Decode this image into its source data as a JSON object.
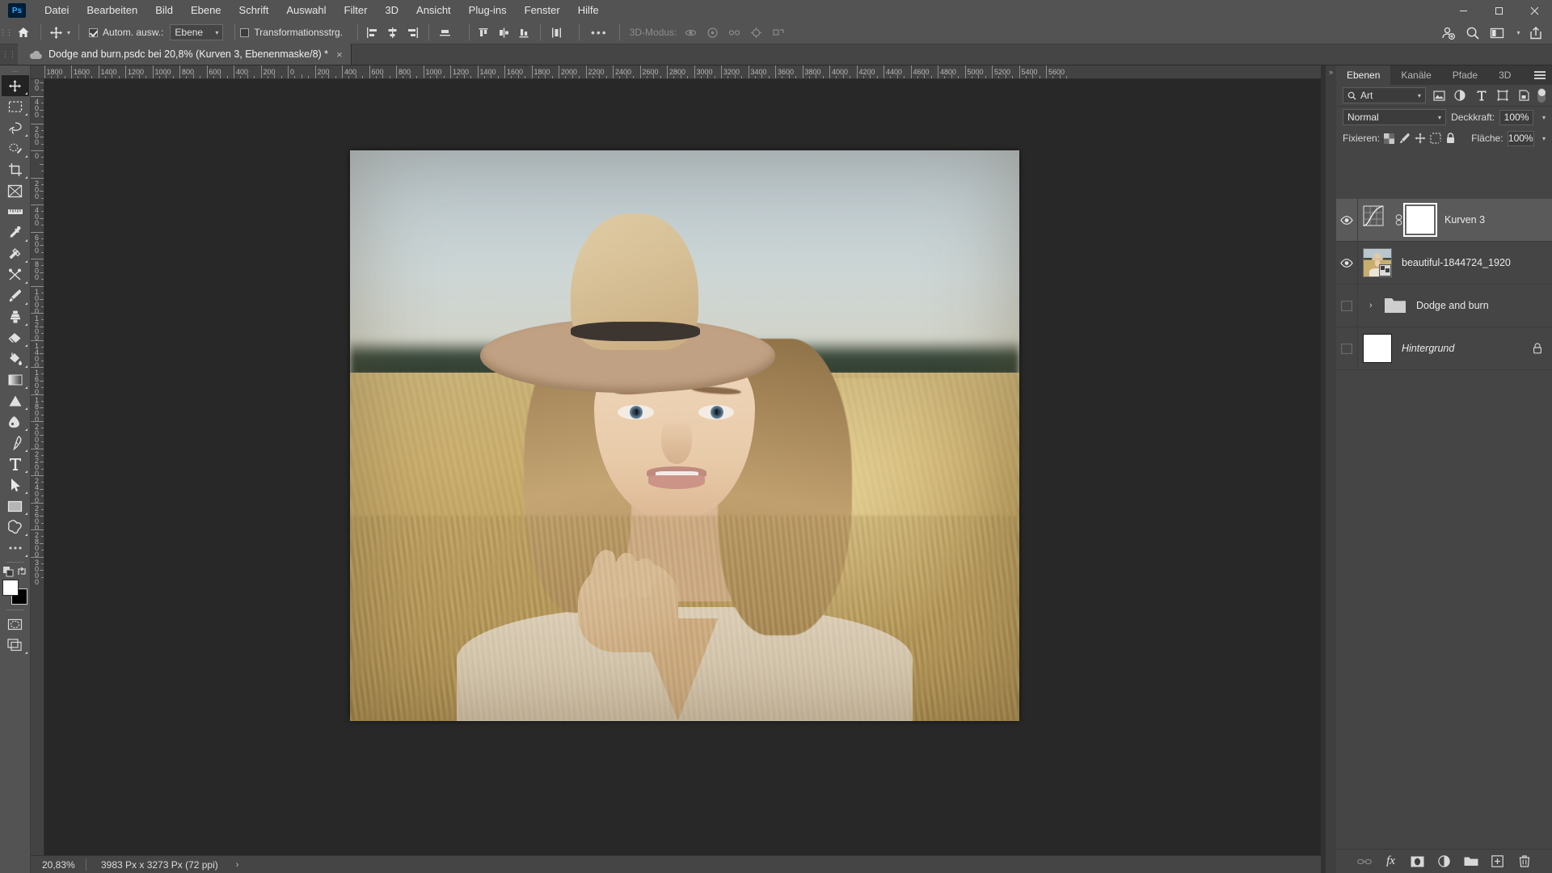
{
  "app": {
    "name": "Ps",
    "accent": "#31a8ff",
    "bg": "#535353",
    "canvas_bg": "#282828"
  },
  "menubar": {
    "items": [
      "Datei",
      "Bearbeiten",
      "Bild",
      "Ebene",
      "Schrift",
      "Auswahl",
      "Filter",
      "3D",
      "Ansicht",
      "Plug-ins",
      "Fenster",
      "Hilfe"
    ],
    "window_controls": [
      "minimize",
      "maximize",
      "close"
    ]
  },
  "optionsbar": {
    "home_icon": "home-icon",
    "tool_icon": "move-tool-icon",
    "auto_select_label": "Autom. ausw.:",
    "auto_select_checked": true,
    "auto_select_scope": "Ebene",
    "transform_controls_label": "Transformationsstrg.",
    "transform_controls_checked": false,
    "align_icons": [
      "align-left-edges-icon",
      "align-horizontal-centers-icon",
      "align-right-edges-icon",
      "align-top-edges-icon"
    ],
    "distribute_icons": [
      "distribute-top-icon",
      "distribute-vertical-centers-icon",
      "distribute-bottom-icon",
      "distribute-spacing-icon"
    ],
    "more_label": "•••",
    "mode3d_label": "3D-Modus:",
    "mode3d_icons": [
      "orbit-3d-icon",
      "roll-3d-icon",
      "pan-3d-icon",
      "slide-3d-icon",
      "scale-3d-icon"
    ],
    "right_icons": [
      "add-collaborator-icon",
      "search-icon",
      "workspace-switcher-icon",
      "share-icon"
    ]
  },
  "document_tab": {
    "title": "Dodge and burn.psdc bei 20,8% (Kurven 3, Ebenenmaske/8) *",
    "cloud_icon": "cloud-document-icon",
    "close_label": "×"
  },
  "toolbar": {
    "tools": [
      {
        "name": "move-tool",
        "selected": true,
        "has_flyout": true
      },
      {
        "name": "rectangular-marquee-tool",
        "selected": false,
        "has_flyout": true
      },
      {
        "name": "lasso-tool",
        "selected": false,
        "has_flyout": true
      },
      {
        "name": "object-selection-tool",
        "selected": false,
        "has_flyout": true
      },
      {
        "name": "crop-tool",
        "selected": false,
        "has_flyout": true
      },
      {
        "name": "frame-tool",
        "selected": false,
        "has_flyout": false
      },
      {
        "name": "measure-tool",
        "selected": false,
        "has_flyout": false
      },
      {
        "name": "eyedropper-tool",
        "selected": false,
        "has_flyout": true
      },
      {
        "name": "healing-brush-tool",
        "selected": false,
        "has_flyout": true
      },
      {
        "name": "patch-tool",
        "selected": false,
        "has_flyout": true
      },
      {
        "name": "brush-tool",
        "selected": false,
        "has_flyout": true
      },
      {
        "name": "clone-stamp-tool",
        "selected": false,
        "has_flyout": true
      },
      {
        "name": "eraser-tool",
        "selected": false,
        "has_flyout": true
      },
      {
        "name": "paint-bucket-tool",
        "selected": false,
        "has_flyout": true
      },
      {
        "name": "gradient-tool",
        "selected": false,
        "has_flyout": true
      },
      {
        "name": "dodge-tool",
        "selected": false,
        "has_flyout": true
      },
      {
        "name": "blur-tool",
        "selected": false,
        "has_flyout": true
      },
      {
        "name": "pen-tool",
        "selected": false,
        "has_flyout": true
      },
      {
        "name": "type-tool",
        "selected": false,
        "has_flyout": true
      },
      {
        "name": "path-selection-tool",
        "selected": false,
        "has_flyout": true
      },
      {
        "name": "rectangle-tool",
        "selected": false,
        "has_flyout": true
      },
      {
        "name": "custom-shape-tool",
        "selected": false,
        "has_flyout": true
      },
      {
        "name": "more-tools",
        "selected": false,
        "has_flyout": true
      }
    ],
    "quickmask_icon": "quick-mask-icon",
    "screenmode_icon": "screen-mode-icon",
    "edit_toolbar_icon": "edit-toolbar-icon",
    "foreground_color": "#ffffff",
    "background_color": "#000000"
  },
  "rulers": {
    "unit": "px",
    "h_labels": [
      "1800",
      "1600",
      "1400",
      "1200",
      "1000",
      "800",
      "600",
      "400",
      "200",
      "0",
      "200",
      "400",
      "600",
      "800",
      "1000",
      "1200",
      "1400",
      "1600",
      "1800",
      "2000",
      "2200",
      "2400",
      "2600",
      "2800",
      "3000",
      "3200",
      "3400",
      "3600",
      "3800",
      "4000",
      "4200",
      "4400",
      "4600",
      "4800",
      "5000",
      "5200",
      "5400",
      "5600"
    ],
    "v_labels": [
      "600",
      "400",
      "200",
      "0",
      "200",
      "400",
      "600",
      "800",
      "1000",
      "1200",
      "1400",
      "1600",
      "1800",
      "2000",
      "2200",
      "2400",
      "2600",
      "2800",
      "3000"
    ]
  },
  "statusbar": {
    "zoom": "20,83%",
    "doc_info": "3983 Px x 3273 Px (72 ppi)",
    "expand_icon": "›"
  },
  "panel": {
    "tabs": [
      {
        "label": "Ebenen",
        "active": true
      },
      {
        "label": "Kanäle",
        "active": false
      },
      {
        "label": "Pfade",
        "active": false
      },
      {
        "label": "3D",
        "active": false
      }
    ],
    "menu_icon": "panel-menu-icon",
    "filter": {
      "search_icon": "search-icon",
      "kind_label": "Art",
      "type_icons": [
        "filter-pixel-layers-icon",
        "filter-adjustment-layers-icon",
        "filter-type-layers-icon",
        "filter-shape-layers-icon",
        "filter-smart-object-icon"
      ],
      "toggle_name": "filter-enable-toggle"
    },
    "blend_mode": "Normal",
    "opacity_label": "Deckkraft:",
    "opacity_value": "100%",
    "lock_label": "Fixieren:",
    "lock_icons": [
      "lock-transparent-pixels-icon",
      "lock-image-pixels-icon",
      "lock-position-icon",
      "lock-artboard-nesting-icon",
      "lock-all-icon"
    ],
    "fill_label": "Fläche:",
    "fill_value": "100%",
    "layers": [
      {
        "name": "Kurven 3",
        "visible": true,
        "selected": true,
        "type": "adjustment",
        "thumb_icon": "curves-adjustment-icon",
        "has_mask": true,
        "mask_linked": true,
        "locked": false,
        "italic": false
      },
      {
        "name": "beautiful-1844724_1920",
        "visible": true,
        "selected": false,
        "type": "smart-object",
        "thumb_icon": "photo-thumbnail",
        "has_mask": false,
        "mask_linked": false,
        "locked": false,
        "italic": false
      },
      {
        "name": "Dodge and burn",
        "visible": false,
        "selected": false,
        "type": "group",
        "thumb_icon": "folder-icon",
        "expanded": false,
        "has_mask": false,
        "mask_linked": false,
        "locked": false,
        "italic": false
      },
      {
        "name": "Hintergrund",
        "visible": false,
        "selected": false,
        "type": "pixel",
        "thumb_icon": "white-thumbnail",
        "has_mask": false,
        "mask_linked": false,
        "locked": true,
        "italic": true
      }
    ],
    "footer_icons": [
      {
        "name": "link-layers-icon",
        "dim": true
      },
      {
        "name": "layer-style-fx-icon",
        "dim": false
      },
      {
        "name": "add-layer-mask-icon",
        "dim": false
      },
      {
        "name": "new-adjustment-layer-icon",
        "dim": false
      },
      {
        "name": "new-group-icon",
        "dim": false
      },
      {
        "name": "new-layer-icon",
        "dim": false
      },
      {
        "name": "delete-layer-icon",
        "dim": false
      }
    ]
  },
  "canvas": {
    "image_alt": "portrait-photo-woman-with-hat-in-wheat-field"
  }
}
